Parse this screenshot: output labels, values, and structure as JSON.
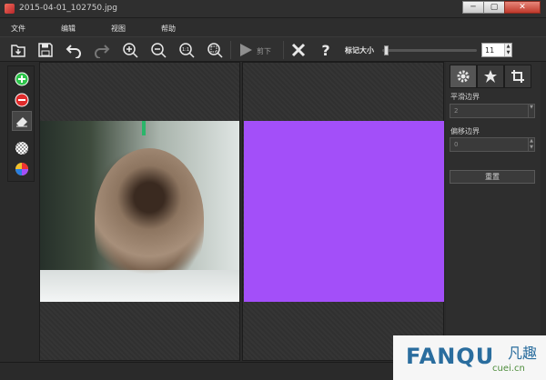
{
  "window": {
    "title": "2015-04-01_102750.jpg",
    "buttons": [
      "─",
      "▢",
      "✕"
    ]
  },
  "menu": [
    "文件",
    "编辑",
    "视图",
    "帮助"
  ],
  "toolbar": {
    "items": [
      "open-icon",
      "save-icon",
      "undo-icon",
      "redo-icon",
      "zoom-in-icon",
      "zoom-out-icon",
      "zoom-actual-icon",
      "zoom-fit-icon"
    ],
    "cut_label": "剪下",
    "brush_size_label": "标记大小",
    "brush_size_value": "11",
    "brush_size_fraction": 0.02
  },
  "tools": [
    "add-foreground-icon",
    "remove-background-icon",
    "eraser-icon",
    "transparency-icon",
    "color-wheel-icon"
  ],
  "panel": {
    "tabs": [
      "settings-icon",
      "star-icon",
      "crop-icon"
    ],
    "smooth_edge_label": "平滑边界",
    "smooth_edge_value": "2",
    "offset_edge_label": "偏移边界",
    "offset_edge_value": "0",
    "reset_label": "重置"
  },
  "colors": {
    "mask": "#a34ff9",
    "add": "#2ec44b",
    "remove": "#e02b2b"
  },
  "watermark": {
    "brand": "FANQU",
    "cn": "凡趣",
    "domain": "cuei.cn"
  }
}
